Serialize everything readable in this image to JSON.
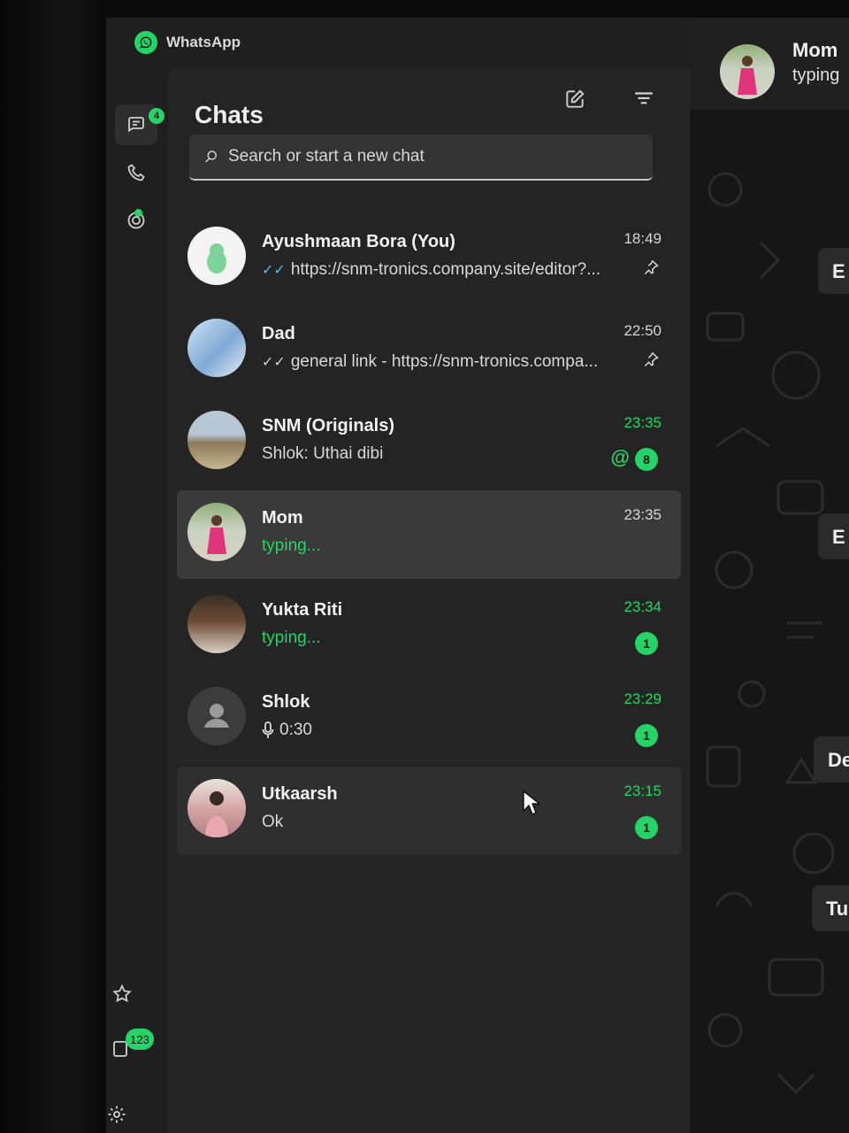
{
  "app": {
    "title": "WhatsApp"
  },
  "rail": {
    "chats_badge": "4",
    "bottom_badge": "123"
  },
  "panel": {
    "title": "Chats",
    "search_placeholder": "Search or start a new chat"
  },
  "chats": [
    {
      "name": "Ayushmaan Bora (You)",
      "preview": "https://snm-tronics.company.site/editor?...",
      "time": "18:49",
      "ticks": "blue",
      "pinned": true
    },
    {
      "name": "Dad",
      "preview": "general link - https://snm-tronics.compa...",
      "time": "22:50",
      "ticks": "grey",
      "pinned": true
    },
    {
      "name": "SNM (Originals)",
      "preview": "Shlok: Uthai dibi",
      "time": "23:35",
      "mention": "@",
      "unread": "8"
    },
    {
      "name": "Mom",
      "preview": "typing...",
      "time": "23:35",
      "typing": true,
      "selected": true
    },
    {
      "name": "Yukta Riti",
      "preview": "typing...",
      "time": "23:34",
      "typing": true,
      "unread": "1"
    },
    {
      "name": "Shlok",
      "preview": "0:30",
      "time": "23:29",
      "unread": "1"
    },
    {
      "name": "Utkaarsh",
      "preview": "Ok",
      "time": "23:15",
      "unread": "1"
    }
  ],
  "conversation": {
    "name": "Mom",
    "status": "typing",
    "bubbles": [
      "E",
      "De",
      "Tu"
    ]
  },
  "colors": {
    "accent": "#25d366",
    "panel": "#242424",
    "selected": "#3a3a3a",
    "read_ticks": "#53bdeb"
  },
  "icons": [
    "whatsapp-logo-icon",
    "chats-icon",
    "calls-icon",
    "status-icon",
    "new-chat-icon",
    "filter-icon",
    "search-icon",
    "pin-icon",
    "mic-icon",
    "star-icon",
    "archive-icon",
    "settings-icon"
  ]
}
